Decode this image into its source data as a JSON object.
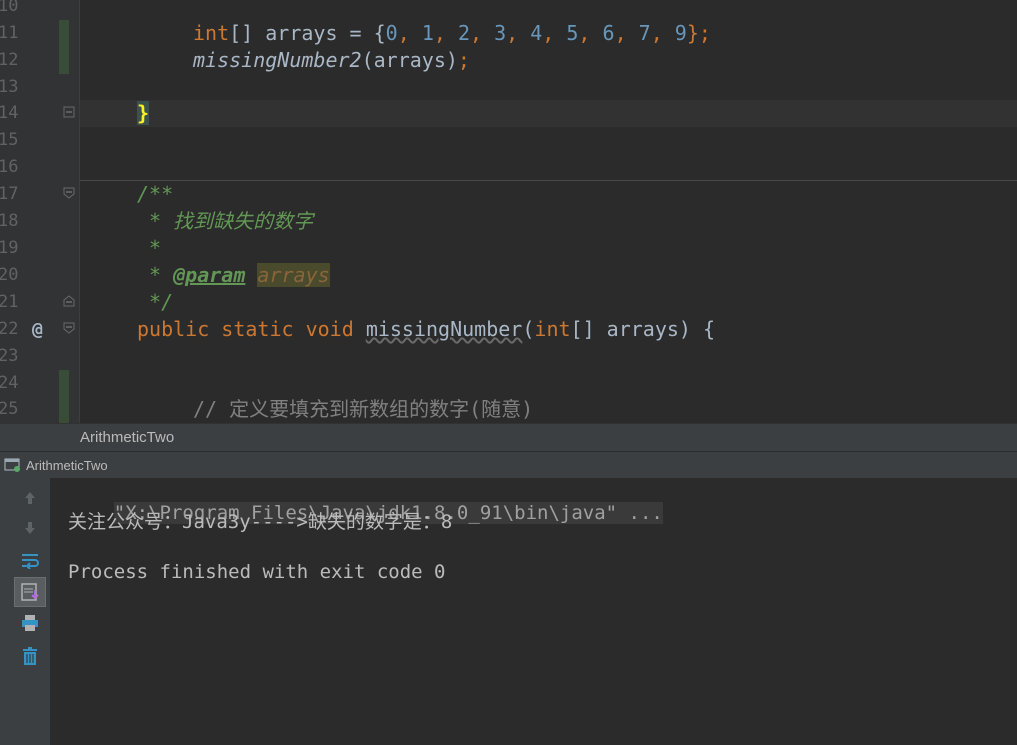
{
  "editor": {
    "lines": [
      {
        "num": "10"
      },
      {
        "num": "11"
      },
      {
        "num": "12"
      },
      {
        "num": "13"
      },
      {
        "num": "14"
      },
      {
        "num": "15"
      },
      {
        "num": "16"
      },
      {
        "num": "17"
      },
      {
        "num": "18"
      },
      {
        "num": "19"
      },
      {
        "num": "20"
      },
      {
        "num": "21"
      },
      {
        "num": "22"
      },
      {
        "num": "23"
      },
      {
        "num": "24"
      },
      {
        "num": "25"
      }
    ],
    "code": {
      "l11_type": "int",
      "l11_rest": "[] arrays = {",
      "l11_nums": [
        "0",
        "1",
        "2",
        "3",
        "4",
        "5",
        "6",
        "7",
        "9"
      ],
      "l11_end": "};",
      "l12_method": "missingNumber2",
      "l12_args": "(arrays)",
      "l12_semi": ";",
      "l14_brace": "}",
      "l17_doc": "/**",
      "l18_doc": " * 找到缺失的数字",
      "l19_doc": " *",
      "l20_doc_star": " * ",
      "l20_tag": "@param",
      "l20_param": "arrays",
      "l21_doc": " */",
      "l22_public": "public",
      "l22_static": "static",
      "l22_void": "void",
      "l22_method": "missingNumber",
      "l22_paren_open": "(",
      "l22_int": "int",
      "l22_rest": "[] arrays) {",
      "l25_comment": "// 定义要填充到新数组的数字(随意)"
    },
    "override_marker": "@"
  },
  "breadcrumb": {
    "text": "ArithmeticTwo"
  },
  "run_panel": {
    "tab_label": "ArithmeticTwo",
    "console": {
      "command": "\"X:\\Program Files\\Java\\jdk1.8.0_91\\bin\\java\" ...",
      "output": "关注公众号：Java3y---->缺失的数字是：8",
      "exit": "Process finished with exit code 0"
    }
  },
  "colors": {
    "editor_bg": "#2b2b2b",
    "keyword": "#cc7832",
    "number": "#6897bb",
    "doc_comment": "#629755",
    "comment": "#808080",
    "text": "#a9b7c6"
  }
}
